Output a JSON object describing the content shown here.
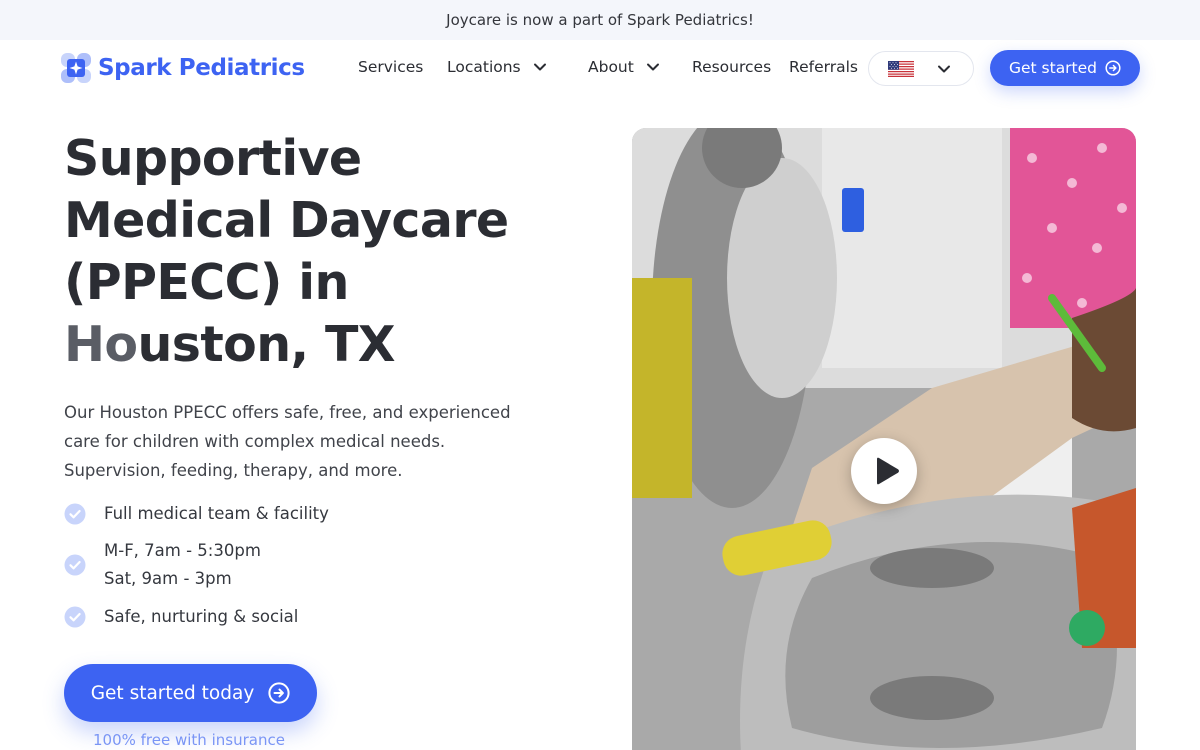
{
  "announcement": "Joycare is now a part of Spark Pediatrics!",
  "brand": {
    "name": "Spark Pediatrics",
    "color": "#3d63f2"
  },
  "nav": {
    "items": [
      {
        "label": "Services",
        "dropdown": false
      },
      {
        "label": "Locations",
        "dropdown": true
      },
      {
        "label": "About",
        "dropdown": true
      },
      {
        "label": "Resources",
        "dropdown": false
      },
      {
        "label": "Referrals",
        "dropdown": false
      }
    ],
    "language_icon": "us-flag-icon",
    "cta_label": "Get started"
  },
  "hero": {
    "title_lines": [
      "Supportive",
      "Medical Daycare",
      "(PPECC) in",
      "Houston, TX"
    ],
    "description_lines": [
      "Our Houston PPECC offers safe, free, and experienced",
      "care for children with complex medical needs.",
      "Supervision, feeding, therapy, and more."
    ],
    "features": [
      {
        "lines": [
          "Full medical team & facility"
        ]
      },
      {
        "lines": [
          "M-F, 7am - 5:30pm",
          "Sat, 9am - 3pm"
        ]
      },
      {
        "lines": [
          "Safe, nurturing & social"
        ]
      }
    ],
    "cta_label": "Get started today",
    "cta_note": "100% free with insurance"
  },
  "media": {
    "type": "video",
    "play_icon": "play-icon"
  }
}
